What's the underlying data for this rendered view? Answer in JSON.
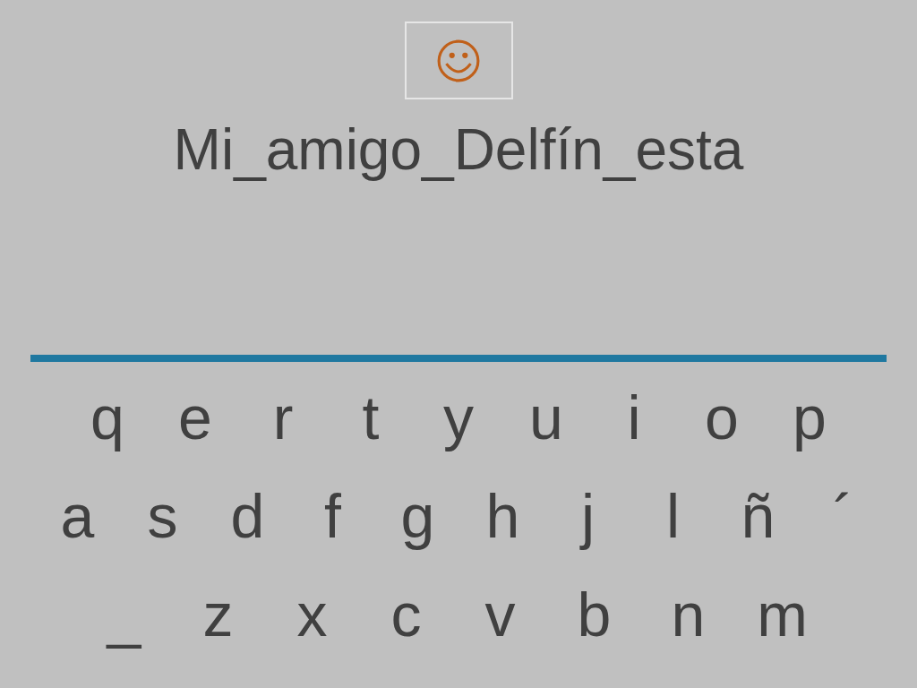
{
  "typed_text": "Mi_amigo_Delfín_esta",
  "keyboard": {
    "rows": [
      [
        "q",
        "e",
        "r",
        "t",
        "y",
        "u",
        "i",
        "o",
        "p"
      ],
      [
        "a",
        "s",
        "d",
        "f",
        "g",
        "h",
        "j",
        "l",
        "ñ",
        "´"
      ],
      [
        "_",
        "z",
        "x",
        "c",
        "v",
        "b",
        "n",
        "m"
      ]
    ]
  }
}
